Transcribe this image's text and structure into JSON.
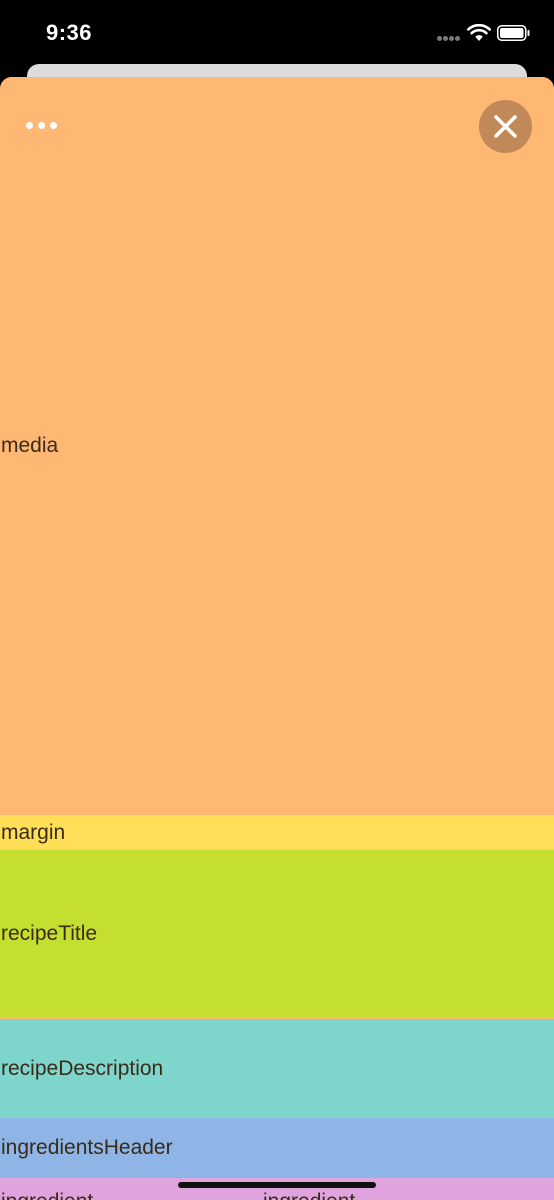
{
  "status_bar": {
    "time": "9:36"
  },
  "sheet": {
    "more_icon": "ellipsis-icon",
    "close_icon": "close-icon",
    "sections": {
      "media": "media",
      "margin": "margin",
      "recipe_title": "recipeTitle",
      "recipe_description": "recipeDescription",
      "ingredients_header": "ingredientsHeader",
      "ingredient_left": "ingredient",
      "ingredient_right": "ingredient"
    }
  },
  "colors": {
    "media": "#ffb874",
    "margin": "#ffdf57",
    "recipe_title": "#c5df31",
    "recipe_description": "#7dd5cc",
    "ingredients_header": "#8eb5e6",
    "ingredient_row": "#dfa3dd",
    "close_button": "#c1895a"
  }
}
